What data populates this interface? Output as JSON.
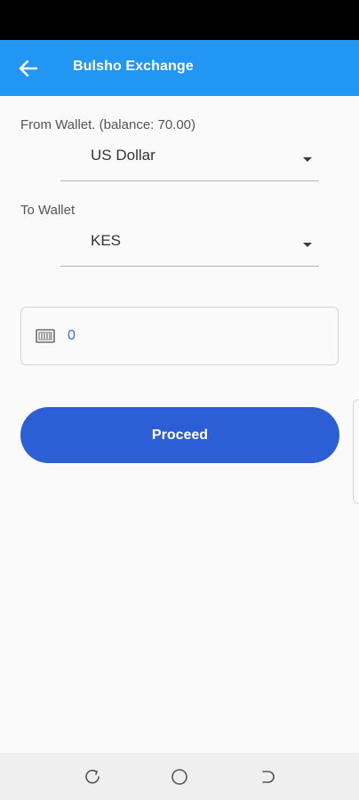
{
  "app_bar": {
    "title": "Bulsho Exchange",
    "color": "#2196f3",
    "back_icon": "arrow-left-icon"
  },
  "from_wallet": {
    "label": "From Wallet. (balance: 70.00)",
    "selected": "US Dollar"
  },
  "to_wallet": {
    "label": "To Wallet",
    "selected": "KES"
  },
  "amount": {
    "icon": "cash-icon",
    "value": "0"
  },
  "proceed": {
    "label": "Proceed",
    "color": "#2c5fd6"
  },
  "nav": {
    "recents_icon": "recents-icon",
    "home_icon": "home-icon",
    "back_icon": "nav-back-icon"
  }
}
